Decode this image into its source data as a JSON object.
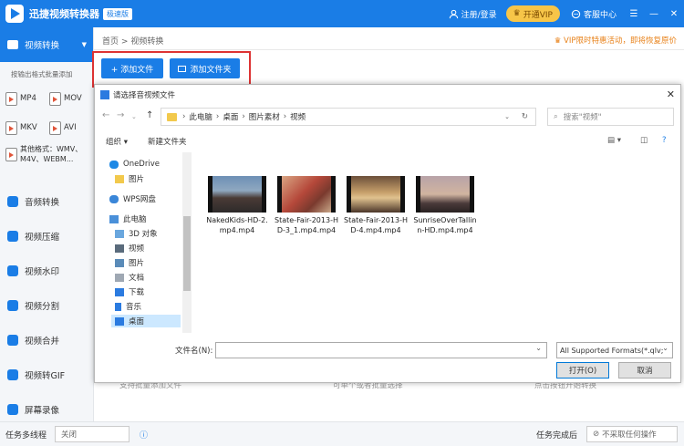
{
  "app": {
    "title": "迅捷视频转换器",
    "edition_badge": "极速版",
    "login": "注册/登录",
    "vip": "开通VIP",
    "service": "客服中心"
  },
  "sidebar": {
    "active": "视频转换",
    "hint": "按输出格式批量添加",
    "formats": [
      "MP4",
      "MOV",
      "MKV",
      "AVI"
    ],
    "other_formats": [
      "其他格式：WMV、",
      "M4V、WEBM..."
    ],
    "items": [
      {
        "label": "音频转换",
        "icon": "music-icon"
      },
      {
        "label": "视频压缩",
        "icon": "compress-icon"
      },
      {
        "label": "视频水印",
        "icon": "watermark-icon"
      },
      {
        "label": "视频分割",
        "icon": "split-icon"
      },
      {
        "label": "视频合并",
        "icon": "merge-icon"
      },
      {
        "label": "视频转GIF",
        "icon": "gif-icon"
      },
      {
        "label": "屏幕录像",
        "icon": "record-icon"
      }
    ]
  },
  "main": {
    "breadcrumb_home": "首页",
    "breadcrumb_sep": ">",
    "breadcrumb_current": "视频转换",
    "promo": "VIP限时特惠活动，即将恢复原价",
    "add_file": "+ 添加文件",
    "add_folder": "添加文件夹",
    "bottom_hints": [
      "支持批量添加文件",
      "可单个或者批量选择",
      "点击按钮开始转换"
    ]
  },
  "statusbar": {
    "multithread_label": "任务多线程",
    "multithread_value": "关闭",
    "complete_label": "任务完成后",
    "complete_value": "不采取任何操作"
  },
  "dialog": {
    "title": "请选择音视频文件",
    "path": [
      "此电脑",
      "桌面",
      "图片素材",
      "视频"
    ],
    "search_placeholder": "搜索\"视频\"",
    "organize": "组织 ▾",
    "new_folder": "新建文件夹",
    "tree": [
      {
        "label": "OneDrive",
        "icon": "cloud-icon"
      },
      {
        "label": "图片",
        "icon": "folder-icon"
      },
      {
        "label": "WPS网盘",
        "icon": "cloud-icon"
      },
      {
        "label": "此电脑",
        "icon": "computer-icon"
      },
      {
        "label": "3D 对象",
        "icon": "cube-icon"
      },
      {
        "label": "视频",
        "icon": "video-folder-icon"
      },
      {
        "label": "图片",
        "icon": "picture-folder-icon"
      },
      {
        "label": "文档",
        "icon": "document-folder-icon"
      },
      {
        "label": "下载",
        "icon": "download-icon"
      },
      {
        "label": "音乐",
        "icon": "music-icon"
      },
      {
        "label": "桌面",
        "icon": "desktop-icon"
      }
    ],
    "files": [
      {
        "name": "NakedKids-HD-2.mp4.mp4"
      },
      {
        "name": "State-Fair-2013-HD-3_1.mp4.mp4"
      },
      {
        "name": "State-Fair-2013-HD-4.mp4.mp4"
      },
      {
        "name": "SunriseOverTallinn-HD.mp4.mp4"
      }
    ],
    "filename_label": "文件名(N):",
    "filename_value": "",
    "filetype": "All Supported Formats(*.qlv;",
    "open_button": "打开(O)",
    "cancel_button": "取消"
  },
  "colors": {
    "accent": "#1a7de6",
    "highlight_box": "#dd3333",
    "vip": "#f7c548",
    "promo": "#e8821a"
  }
}
